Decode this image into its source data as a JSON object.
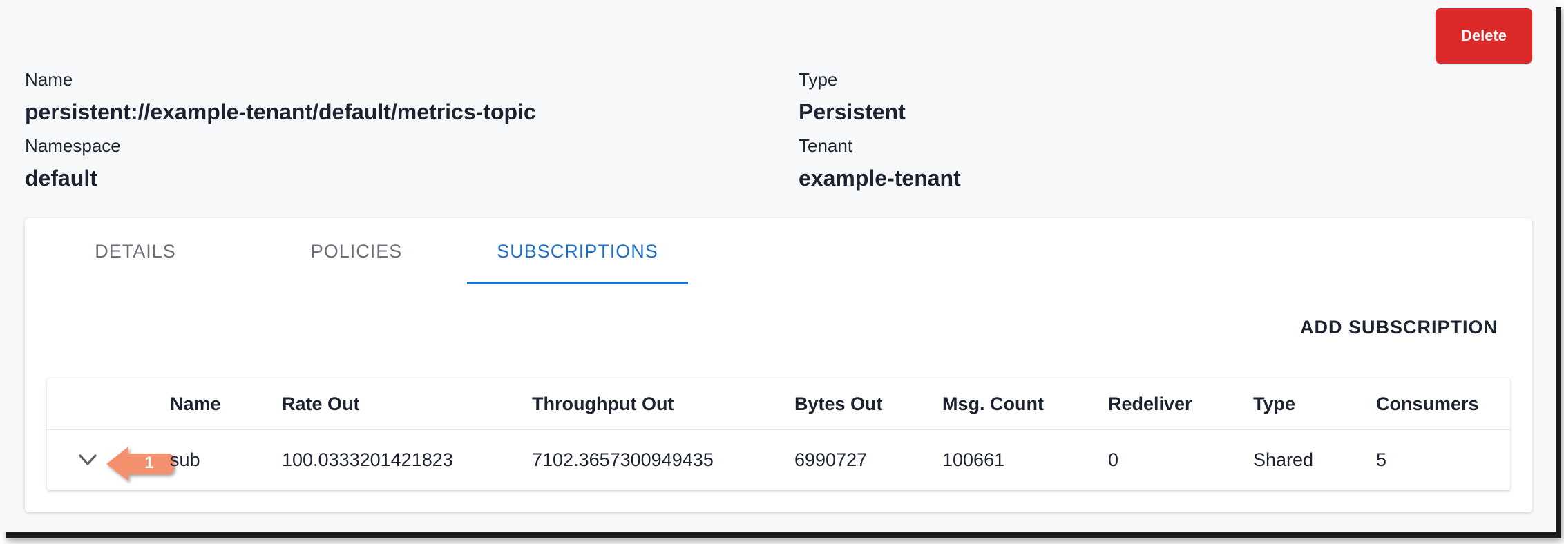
{
  "actions": {
    "delete_label": "Delete"
  },
  "details": {
    "name_label": "Name",
    "name_value": "persistent://example-tenant/default/metrics-topic",
    "type_label": "Type",
    "type_value": "Persistent",
    "namespace_label": "Namespace",
    "namespace_value": "default",
    "tenant_label": "Tenant",
    "tenant_value": "example-tenant"
  },
  "tabs": [
    {
      "label": "DETAILS"
    },
    {
      "label": "POLICIES"
    },
    {
      "label": "SUBSCRIPTIONS"
    }
  ],
  "active_tab": "SUBSCRIPTIONS",
  "subscriptions": {
    "add_label": "ADD SUBSCRIPTION",
    "columns": [
      "Name",
      "Rate Out",
      "Throughput Out",
      "Bytes Out",
      "Msg. Count",
      "Redeliver",
      "Type",
      "Consumers"
    ],
    "rows": [
      {
        "name": "sub",
        "rate_out": "100.0333201421823",
        "throughput_out": "7102.3657300949435",
        "bytes_out": "6990727",
        "msg_count": "100661",
        "redeliver": "0",
        "type": "Shared",
        "consumers": "5"
      }
    ]
  },
  "annotation": {
    "step_number": "1"
  },
  "colors": {
    "delete_bg": "#dc2a2a",
    "active_tab": "#1f6fc9",
    "callout": "#f4906e"
  }
}
